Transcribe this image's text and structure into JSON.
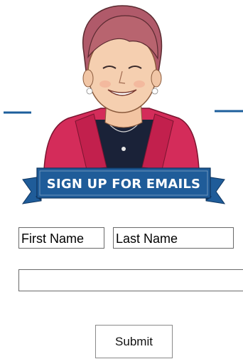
{
  "banner": {
    "text": "SIGN UP FOR EMAILS"
  },
  "form": {
    "first_name_placeholder": "First Name",
    "last_name_placeholder": "Last Name",
    "email_placeholder": "",
    "submit_label": "Submit"
  },
  "colors": {
    "accent_blue": "#1d5f9c",
    "banner_blue": "#1f5c99",
    "jacket_pink": "#d42c5a"
  }
}
